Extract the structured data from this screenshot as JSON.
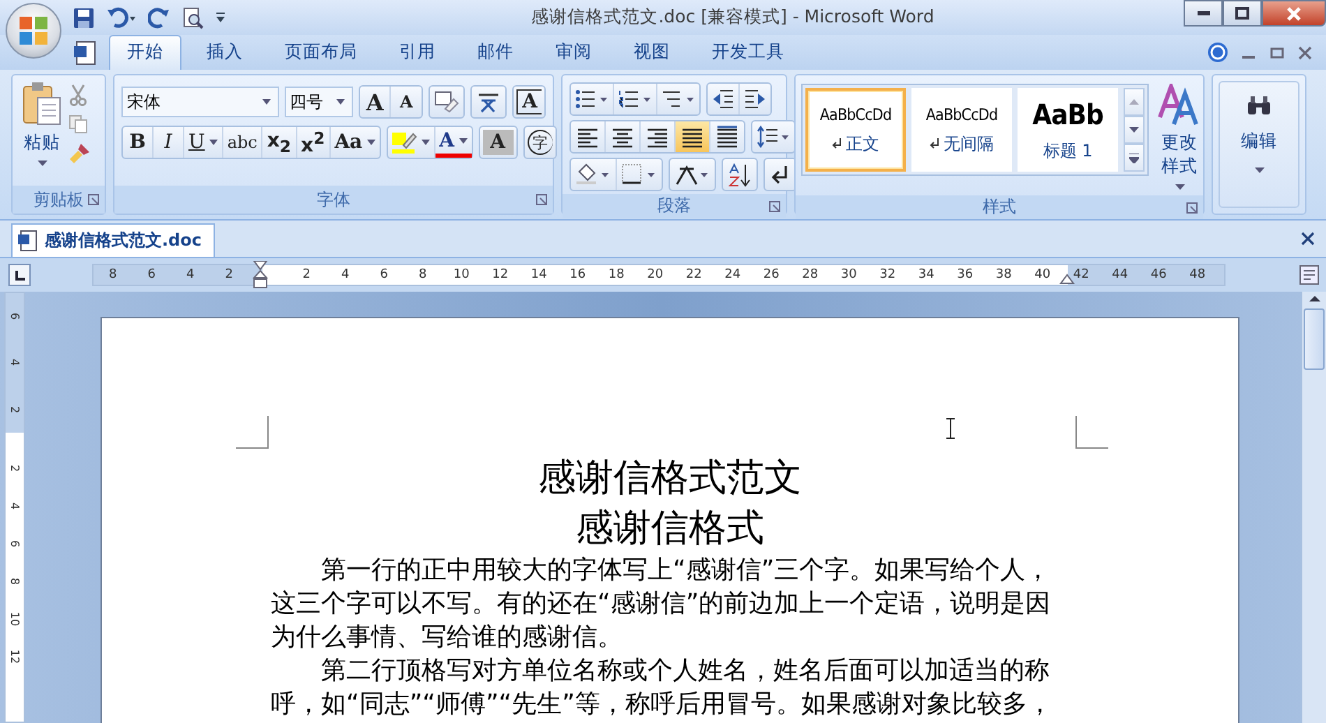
{
  "window": {
    "title": "感谢信格式范文.doc [兼容模式] - Microsoft Word"
  },
  "tabs": [
    {
      "label": "开始",
      "selected": true
    },
    {
      "label": "插入",
      "selected": false
    },
    {
      "label": "页面布局",
      "selected": false
    },
    {
      "label": "引用",
      "selected": false
    },
    {
      "label": "邮件",
      "selected": false
    },
    {
      "label": "审阅",
      "selected": false
    },
    {
      "label": "视图",
      "selected": false
    },
    {
      "label": "开发工具",
      "selected": false
    }
  ],
  "clipboard": {
    "paste_label": "粘贴",
    "group_label": "剪贴板"
  },
  "font": {
    "group_label": "字体",
    "font_name": "宋体",
    "font_size": "四号",
    "size_buttons": [
      {
        "label": "A",
        "kind": "grow"
      },
      {
        "label": "A",
        "kind": "shrink"
      }
    ],
    "border_button": "A",
    "format_buttons": [
      {
        "label": "B",
        "kind": "bold",
        "dropdown": false
      },
      {
        "label": "I",
        "kind": "italic",
        "dropdown": false
      },
      {
        "label": "U",
        "kind": "underline",
        "dropdown": true
      },
      {
        "label": "abc",
        "kind": "strike",
        "dropdown": false
      },
      {
        "label": "x$_{2}$",
        "kind": "sub",
        "dropdown": false
      },
      {
        "label": "x$^{2}$",
        "kind": "super",
        "dropdown": false
      },
      {
        "label": "Aa",
        "kind": "case",
        "dropdown": true
      }
    ],
    "color_label": "A",
    "shade_button": "A",
    "enclosed_button": "字"
  },
  "paragraph": {
    "group_label": "段落",
    "alignments": [
      {
        "kind": "left",
        "selected": false
      },
      {
        "kind": "center",
        "selected": false
      },
      {
        "kind": "right",
        "selected": false
      },
      {
        "kind": "justify",
        "selected": true
      },
      {
        "kind": "distributed",
        "selected": false
      }
    ]
  },
  "styles": {
    "group_label": "样式",
    "change_label": "更改样式",
    "items": [
      {
        "preview": "AaBbCcDd",
        "name": "正文",
        "kind": "body",
        "mark": true,
        "selected": true
      },
      {
        "preview": "AaBbCcDd",
        "name": "无间隔",
        "kind": "body",
        "mark": true,
        "selected": false
      },
      {
        "preview": "AaBb",
        "name": "标题 1",
        "kind": "heading",
        "mark": false,
        "selected": false
      }
    ]
  },
  "editing": {
    "group_label": "编辑"
  },
  "document_tab": {
    "title": "感谢信格式范文.doc"
  },
  "ruler": {
    "left_labels": [
      "8",
      "6",
      "4",
      "2"
    ],
    "right_labels": [
      "2",
      "4",
      "6",
      "8",
      "10",
      "12",
      "14",
      "16",
      "18",
      "20",
      "22",
      "24",
      "26",
      "28",
      "30",
      "32",
      "34",
      "36",
      "38",
      "40",
      "42",
      "44",
      "46",
      "48"
    ]
  },
  "vertical_ruler": {
    "top_labels": [
      "6",
      "4",
      "2"
    ],
    "bottom_labels": [
      "2",
      "4",
      "6",
      "8",
      "10",
      "12"
    ]
  },
  "document": {
    "title": "感谢信格式范文",
    "subtitle": "感谢信格式",
    "paragraphs": [
      "第一行的正中用较大的字体写上“感谢信”三个字。如果写给个人，这三个字可以不写。有的还在“感谢信”的前边加上一个定语，说明是因为什么事情、写给谁的感谢信。",
      "第二行顶格写对方单位名称或个人姓名，姓名后面可以加适当的称呼，如“同志”“师傅”“先生”等，称呼后用冒号。如果感谢对象比较多，"
    ]
  }
}
